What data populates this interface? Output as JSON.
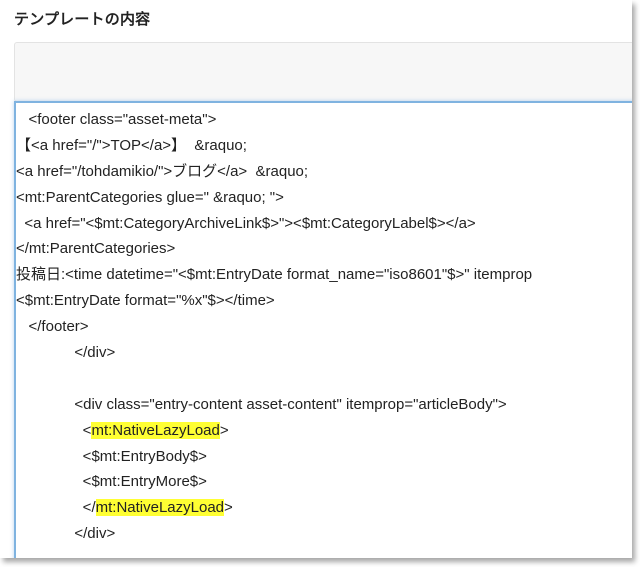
{
  "section_title": "テンプレートの内容",
  "code_lines": [
    {
      "pre": "   <footer class=\"asset-meta\">",
      "hl": "",
      "post": ""
    },
    {
      "pre": "【<a href=\"/\">TOP</a>】  &raquo;",
      "hl": "",
      "post": ""
    },
    {
      "pre": "<a href=\"/tohdamikio/\">ブログ</a>  &raquo;",
      "hl": "",
      "post": ""
    },
    {
      "pre": "<mt:ParentCategories glue=\" &raquo; \">",
      "hl": "",
      "post": ""
    },
    {
      "pre": "  <a href=\"<$mt:CategoryArchiveLink$>\"><$mt:CategoryLabel$></a>",
      "hl": "",
      "post": ""
    },
    {
      "pre": "</mt:ParentCategories>",
      "hl": "",
      "post": ""
    },
    {
      "pre": "投稿日:<time datetime=\"<$mt:EntryDate format_name=\"iso8601\"$>\" itemprop",
      "hl": "",
      "post": ""
    },
    {
      "pre": "<$mt:EntryDate format=\"%x\"$></time>",
      "hl": "",
      "post": ""
    },
    {
      "pre": "   </footer>",
      "hl": "",
      "post": ""
    },
    {
      "pre": "              </div>",
      "hl": "",
      "post": ""
    },
    {
      "pre": "",
      "hl": "",
      "post": ""
    },
    {
      "pre": "              <div class=\"entry-content asset-content\" itemprop=\"articleBody\">",
      "hl": "",
      "post": ""
    },
    {
      "pre": "                <",
      "hl": "mt:NativeLazyLoad",
      "post": ">"
    },
    {
      "pre": "                <$mt:EntryBody$>",
      "hl": "",
      "post": ""
    },
    {
      "pre": "                <$mt:EntryMore$>",
      "hl": "",
      "post": ""
    },
    {
      "pre": "                </",
      "hl": "mt:NativeLazyLoad",
      "post": ">"
    },
    {
      "pre": "              </div>",
      "hl": "",
      "post": ""
    }
  ],
  "colors": {
    "highlight": "#ffff33",
    "editor_focus_border": "#7fb3e0",
    "toolbar_bg": "#f7f7f7"
  }
}
